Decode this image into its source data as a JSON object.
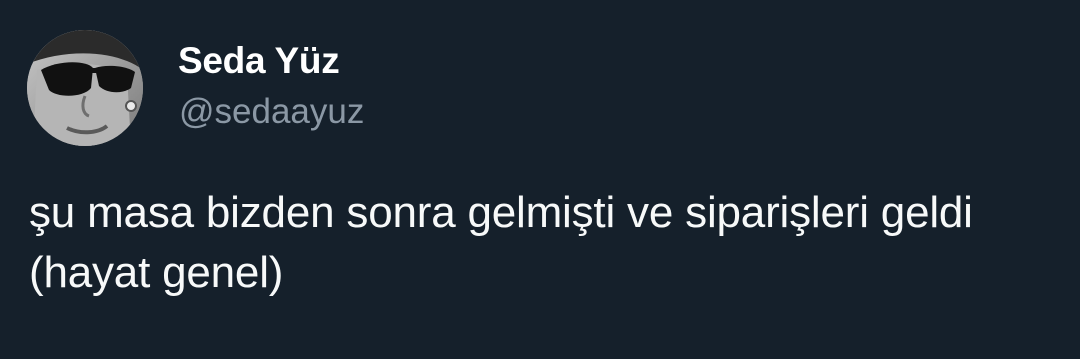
{
  "author": {
    "display_name": "Seda Yüz",
    "handle": "@sedaayuz",
    "avatar_icon": "profile-photo-sunglasses"
  },
  "tweet": {
    "text": "şu masa bizden sonra gelmişti ve siparişleri geldi (hayat genel)"
  },
  "colors": {
    "background": "#15202b",
    "text": "#f7f9f9",
    "handle": "#8b98a5"
  }
}
